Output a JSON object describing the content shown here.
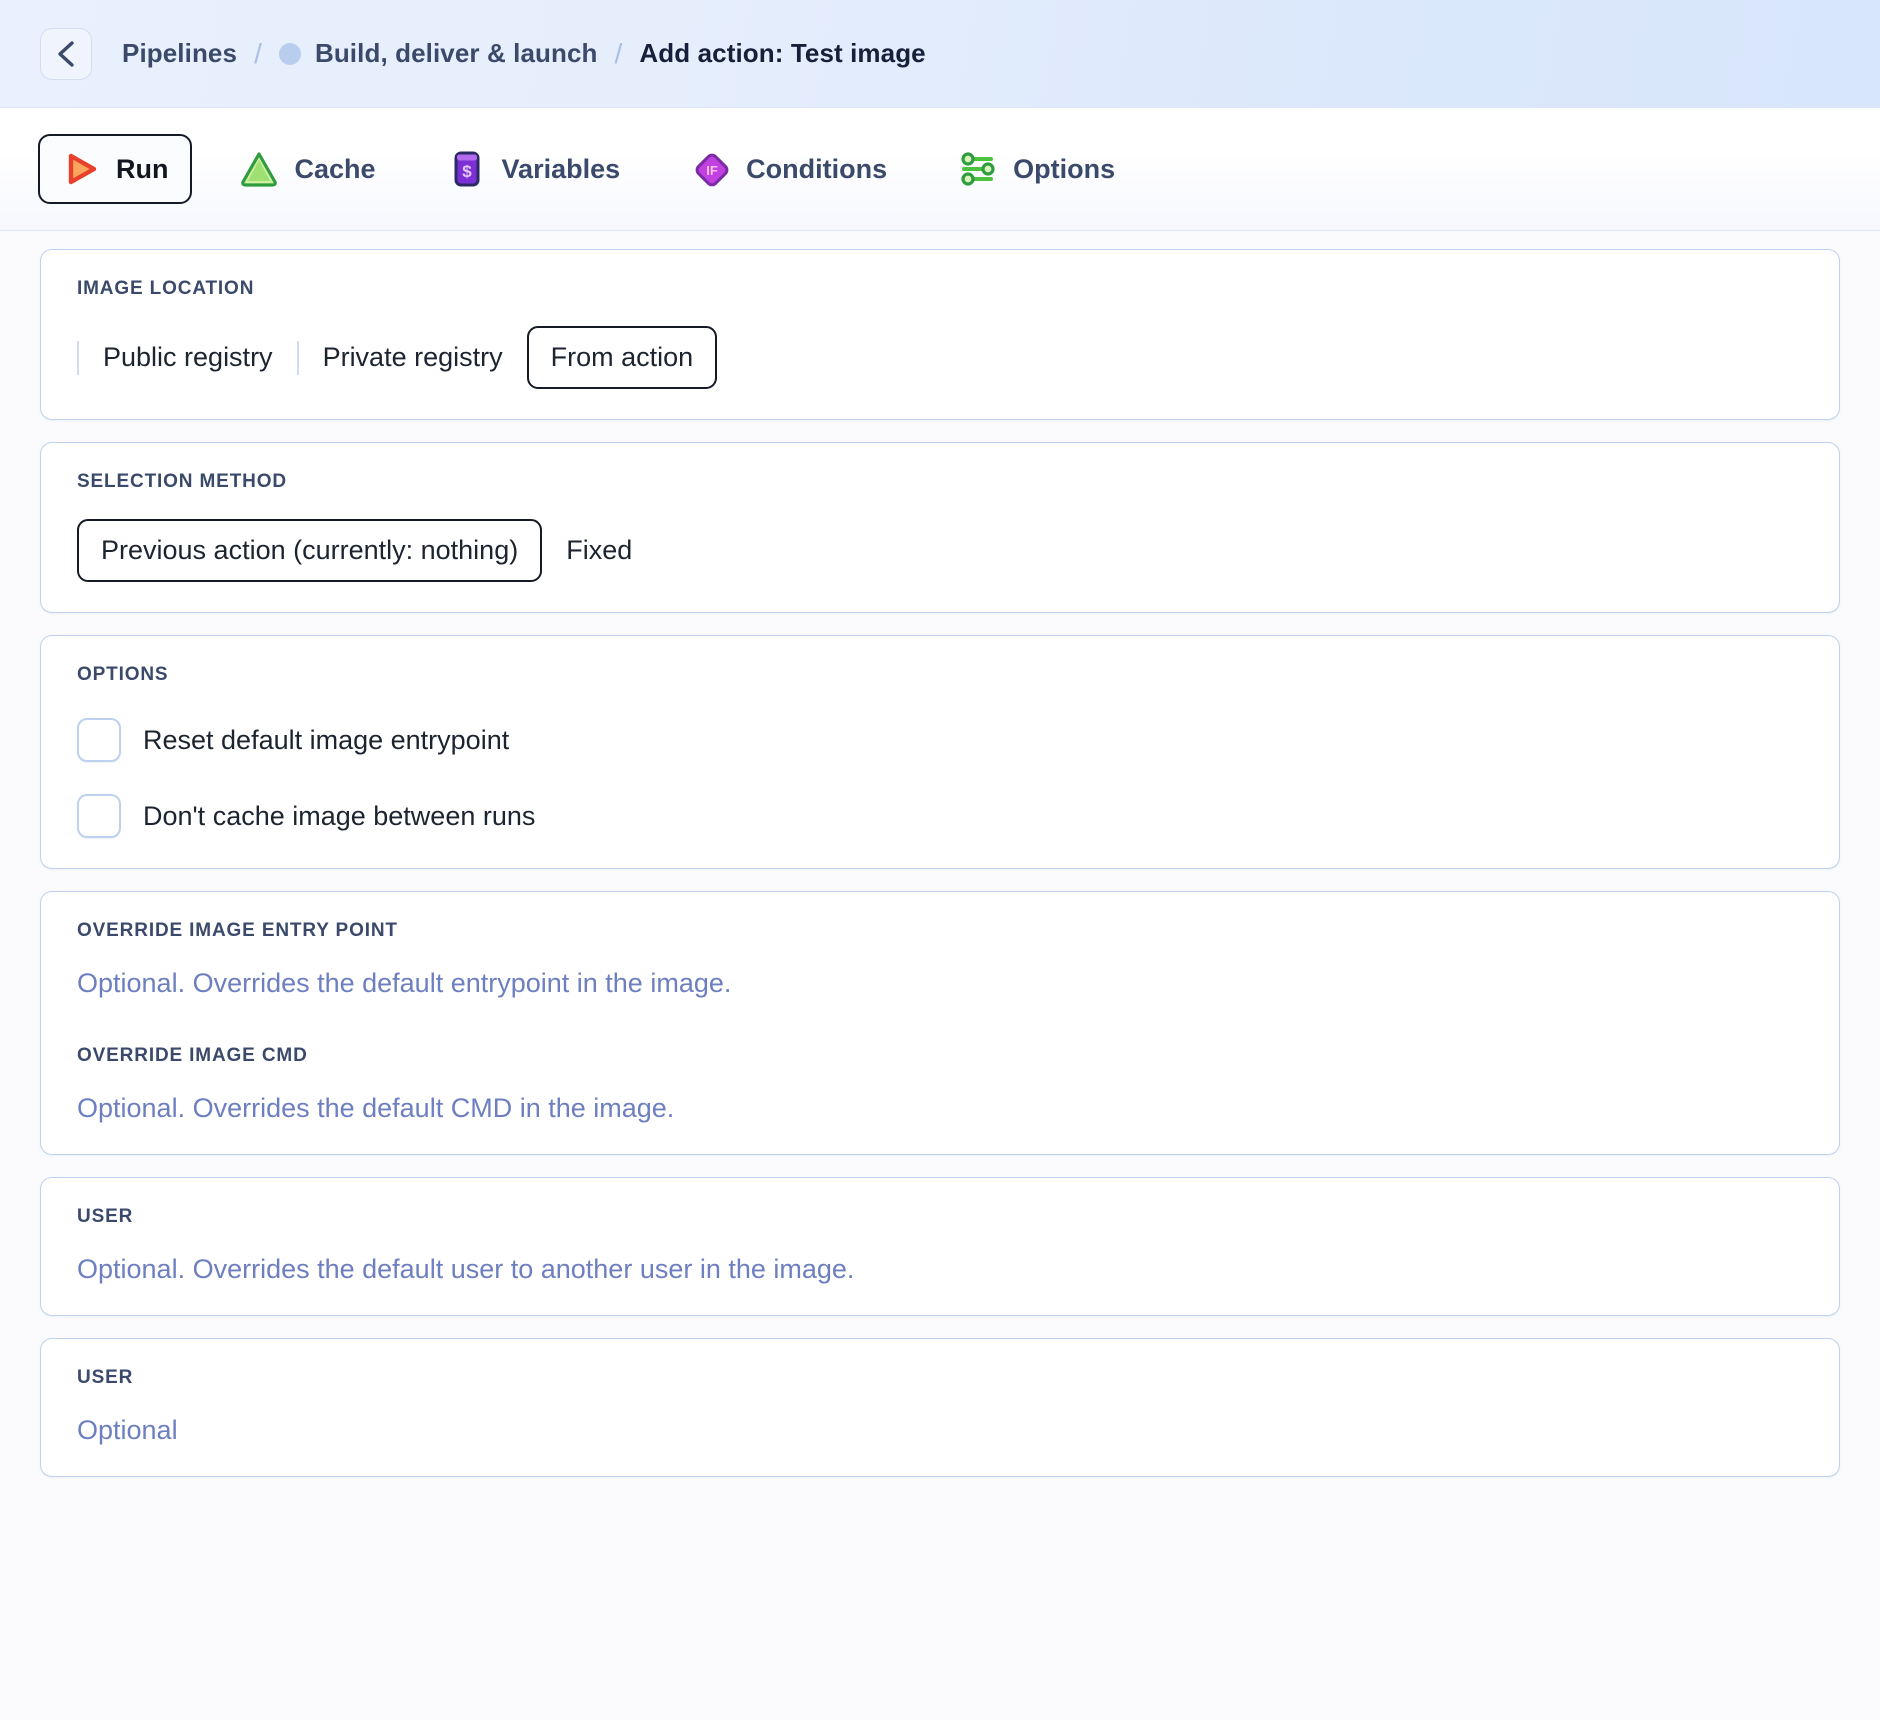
{
  "header": {
    "back_icon": "chevron-left-icon",
    "breadcrumb": {
      "root": "Pipelines",
      "separator": "/",
      "pipeline": "Build, deliver & launch",
      "current": "Add action: Test image"
    }
  },
  "tabs": [
    {
      "label": "Run",
      "icon": "play-icon",
      "active": true
    },
    {
      "label": "Cache",
      "icon": "cache-icon",
      "active": false
    },
    {
      "label": "Variables",
      "icon": "variables-icon",
      "active": false
    },
    {
      "label": "Conditions",
      "icon": "condition-if-icon",
      "active": false
    },
    {
      "label": "Options",
      "icon": "sliders-icon",
      "active": false
    }
  ],
  "sections": {
    "image_location": {
      "label": "Image location",
      "options": [
        "Public registry",
        "Private registry",
        "From action"
      ],
      "selected": "From action"
    },
    "selection_method": {
      "label": "Selection method",
      "options": [
        "Previous action (currently: nothing)",
        "Fixed"
      ],
      "selected": "Previous action (currently: nothing)"
    },
    "options": {
      "label": "Options",
      "checkboxes": [
        {
          "label": "Reset default image entrypoint",
          "checked": false
        },
        {
          "label": "Don't cache image between runs",
          "checked": false
        }
      ]
    },
    "override_entrypoint": {
      "label": "Override image entry point",
      "placeholder": "Optional. Overrides the default entrypoint in the image.",
      "value": ""
    },
    "override_cmd": {
      "label": "Override image CMD",
      "placeholder": "Optional. Overrides the default CMD in the image.",
      "value": ""
    },
    "user_override": {
      "label": "User",
      "placeholder": "Optional. Overrides the default user to another user in the image.",
      "value": ""
    },
    "user_plain": {
      "label": "User",
      "placeholder": "Optional",
      "value": ""
    }
  },
  "colors": {
    "accent_blue": "#6d7fc0",
    "card_border": "#bed1ee",
    "header_gradient_start": "#eaf0fd",
    "header_gradient_end": "#d8e6fb",
    "run_icon_orange": "#f9853f",
    "run_icon_red": "#e8402a",
    "cache_icon_green": "#3eb44a",
    "variables_icon_purple": "#8b3fe0",
    "conditions_icon_purple": "#bd3ee0",
    "options_icon_green": "#3eb44a",
    "selected_outline": "#141a26",
    "text_dark": "#1c2430",
    "text_muted": "#3b4a6b"
  }
}
